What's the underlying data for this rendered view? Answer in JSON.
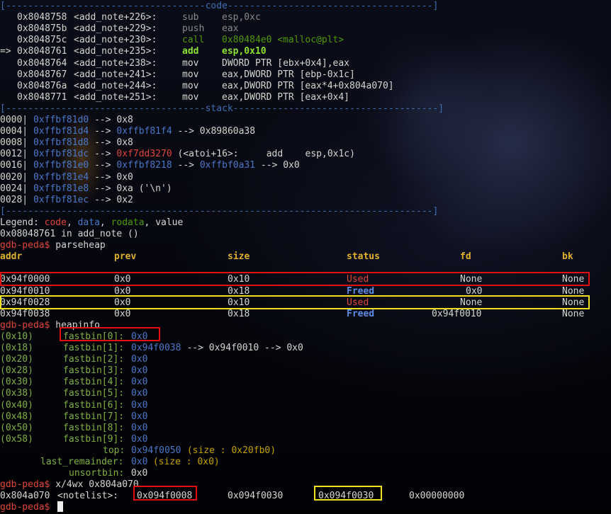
{
  "code_sep": "[------------------------------------code-------------------------------------]",
  "stack_sep": "[------------------------------------stack-------------------------------------]",
  "end_sep": "[-----------------------------------------------------------------------------]",
  "code": [
    {
      "arrow": "",
      "addr": "0x8048758",
      "fn": "<add_note+226>:",
      "op": "sub",
      "args": "esp,0xc",
      "style": "g"
    },
    {
      "arrow": "",
      "addr": "0x804875b",
      "fn": "<add_note+229>:",
      "op": "push",
      "args": "eax",
      "style": "g"
    },
    {
      "arrow": "",
      "addr": "0x804875c",
      "fn": "<add_note+230>:",
      "op": "call",
      "args": "0x80484e0 <malloc@plt>",
      "style": "call"
    },
    {
      "arrow": "=>",
      "addr": "0x8048761",
      "fn": "<add_note+235>:",
      "op": "add",
      "args": "esp,0x10",
      "style": "cur"
    },
    {
      "arrow": "",
      "addr": "0x8048764",
      "fn": "<add_note+238>:",
      "op": "mov",
      "args": "DWORD PTR [ebx+0x4],eax",
      "style": "w"
    },
    {
      "arrow": "",
      "addr": "0x8048767",
      "fn": "<add_note+241>:",
      "op": "mov",
      "args": "eax,DWORD PTR [ebp-0x1c]",
      "style": "w"
    },
    {
      "arrow": "",
      "addr": "0x804876a",
      "fn": "<add_note+244>:",
      "op": "mov",
      "args": "eax,DWORD PTR [eax*4+0x804a070]",
      "style": "w"
    },
    {
      "arrow": "",
      "addr": "0x8048771",
      "fn": "<add_note+251>:",
      "op": "mov",
      "args": "eax,DWORD PTR [eax+0x4]",
      "style": "w"
    }
  ],
  "stack": [
    {
      "off": "0000|",
      "addr": "0xffbf81d0",
      "rest": [
        {
          "t": " --> 0x8",
          "c": "w"
        }
      ]
    },
    {
      "off": "0004|",
      "addr": "0xffbf81d4",
      "rest": [
        {
          "t": " --> ",
          "c": "w"
        },
        {
          "t": "0xffbf81f4",
          "c": "blue"
        },
        {
          "t": " --> 0x89860a38",
          "c": "w"
        }
      ]
    },
    {
      "off": "0008|",
      "addr": "0xffbf81d8",
      "rest": [
        {
          "t": " --> 0x8",
          "c": "w"
        }
      ]
    },
    {
      "off": "0012|",
      "addr": "0xffbf81dc",
      "rest": [
        {
          "t": " --> ",
          "c": "w"
        },
        {
          "t": "0xf7dd3270",
          "c": "red"
        },
        {
          "t": " (<atoi+16>:     add    esp,0x1c)",
          "c": "w"
        }
      ]
    },
    {
      "off": "0016|",
      "addr": "0xffbf81e0",
      "rest": [
        {
          "t": " --> ",
          "c": "w"
        },
        {
          "t": "0xffbf8218",
          "c": "blue"
        },
        {
          "t": " --> ",
          "c": "w"
        },
        {
          "t": "0xffbf0a31",
          "c": "blue"
        },
        {
          "t": " --> 0x0",
          "c": "w"
        }
      ]
    },
    {
      "off": "0020|",
      "addr": "0xffbf81e4",
      "rest": [
        {
          "t": " --> 0x0",
          "c": "w"
        }
      ]
    },
    {
      "off": "0024|",
      "addr": "0xffbf81e8",
      "rest": [
        {
          "t": " --> 0xa ('\\n')",
          "c": "w"
        }
      ]
    },
    {
      "off": "0028|",
      "addr": "0xffbf81ec",
      "rest": [
        {
          "t": " --> 0x2",
          "c": "w"
        }
      ]
    }
  ],
  "legend": {
    "label": "Legend: ",
    "code": "code",
    "data": "data",
    "rodata": "rodata",
    "value": "value"
  },
  "location": "0x08048761 in add_note ()",
  "prompt": "gdb-peda$",
  "cmd_parseheap": " parseheap",
  "cmd_heapinfo": " heapinfo",
  "cmd_x": " x/4wx 0x804a070",
  "heap_headers": {
    "addr": "addr",
    "prev": "prev",
    "size": "size",
    "status": "status",
    "fd": "fd",
    "bk": "bk"
  },
  "heap_rows": [
    {
      "addr": "0x94f0000",
      "prev": "0x0",
      "size": "0x10",
      "status": "Used",
      "fd": "None",
      "bk": "None"
    },
    {
      "addr": "0x94f0010",
      "prev": "0x0",
      "size": "0x18",
      "status": "Freed",
      "fd": "0x0",
      "bk": "None"
    },
    {
      "addr": "0x94f0028",
      "prev": "0x0",
      "size": "0x10",
      "status": "Used",
      "fd": "None",
      "bk": "None"
    },
    {
      "addr": "0x94f0038",
      "prev": "0x0",
      "size": "0x18",
      "status": "Freed",
      "fd": "0x94f0010",
      "bk": "None"
    }
  ],
  "fastbins": [
    {
      "sz": "(0x10)",
      "name": "fastbin[0]:",
      "val": "0x0",
      "chain": ""
    },
    {
      "sz": "(0x18)",
      "name": "fastbin[1]:",
      "val": "0x94f0038",
      "chain": " --> 0x94f0010 --> 0x0"
    },
    {
      "sz": "(0x20)",
      "name": "fastbin[2]:",
      "val": "0x0",
      "chain": ""
    },
    {
      "sz": "(0x28)",
      "name": "fastbin[3]:",
      "val": "0x0",
      "chain": ""
    },
    {
      "sz": "(0x30)",
      "name": "fastbin[4]:",
      "val": "0x0",
      "chain": ""
    },
    {
      "sz": "(0x38)",
      "name": "fastbin[5]:",
      "val": "0x0",
      "chain": ""
    },
    {
      "sz": "(0x40)",
      "name": "fastbin[6]:",
      "val": "0x0",
      "chain": ""
    },
    {
      "sz": "(0x48)",
      "name": "fastbin[7]:",
      "val": "0x0",
      "chain": ""
    },
    {
      "sz": "(0x50)",
      "name": "fastbin[8]:",
      "val": "0x0",
      "chain": ""
    },
    {
      "sz": "(0x58)",
      "name": "fastbin[9]:",
      "val": "0x0",
      "chain": ""
    }
  ],
  "top": {
    "label": "top:",
    "addr": "0x94f0050",
    "extra": " (size : 0x20fb0)"
  },
  "last_remainder": {
    "label": "last_remainder:",
    "addr": "0x0",
    "extra": " (size : 0x0)"
  },
  "unsortbin": {
    "label": "unsortbin:",
    "val": " 0x0"
  },
  "memdump": {
    "addr": "0x804a070",
    "sym": "<notelist>:",
    "v": [
      "0x094f0008",
      "0x094f0030",
      "0x094f0030",
      "0x00000000"
    ]
  }
}
